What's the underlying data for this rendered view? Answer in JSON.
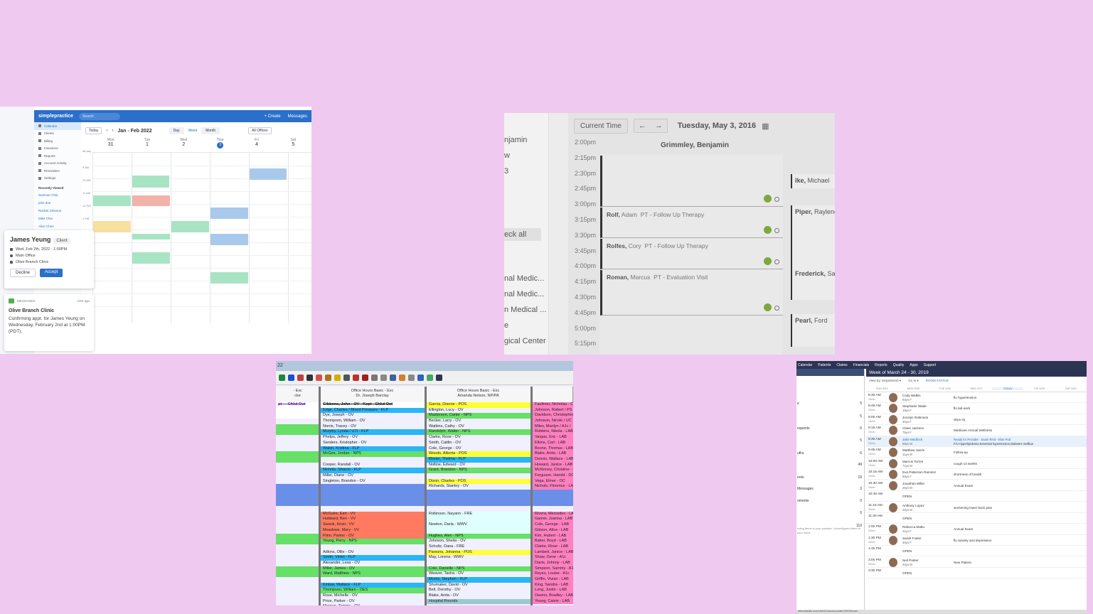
{
  "p1": {
    "logo": "simplepractice",
    "search": "Search",
    "create": "+ Create",
    "messages": "Messages",
    "sidebar": [
      "Calendar",
      "Clients",
      "Billing",
      "Insurance",
      "Reports",
      "Account Activity",
      "Reminders",
      "Settings"
    ],
    "recently_viewed": "Recently Viewed",
    "recent": [
      "Summer Chie",
      "john doe",
      "Rachel Johnson",
      "Mike Chin",
      "Alice Chen"
    ],
    "today": "Today",
    "month_label": "Jan - Feb 2022",
    "views": [
      "Day",
      "Week",
      "Month"
    ],
    "offices": "All Offices",
    "days": [
      {
        "n": "Mon",
        "d": "31"
      },
      {
        "n": "Tue",
        "d": "1"
      },
      {
        "n": "Wed",
        "d": "2"
      },
      {
        "n": "Thur",
        "d": "3"
      },
      {
        "n": "Fri",
        "d": "4"
      },
      {
        "n": "Sat",
        "d": "5"
      }
    ],
    "allday": "all-day",
    "times": [
      "9 AM",
      "10 AM",
      "11 AM",
      "12 PM",
      "1 PM"
    ],
    "card": {
      "name": "James Yeung",
      "tag": "Client",
      "date": "Wed, Feb 2th, 2022 - 1:00PM",
      "office": "Main Office",
      "clinic": "Olive Branch Clinic",
      "decline": "Decline",
      "accept": "Accept"
    },
    "msg": {
      "label": "MESSAGES",
      "ago": "10m ago",
      "title": "Olive Branch Clinic",
      "body": "Confirming appt. for James Yeung on Wednesday, February 2nd at 1:00PM (PDT)."
    }
  },
  "p2": {
    "current_time": "Current Time",
    "prev": "←",
    "next": "→",
    "date": "Tuesday, May 3, 2016",
    "provider": "Grimmley, Benjamin",
    "times": [
      "2:00pm",
      "2:15pm",
      "2:30pm",
      "2:45pm",
      "3:00pm",
      "3:15pm",
      "3:30pm",
      "3:45pm",
      "4:00pm",
      "4:15pm",
      "4:30pm",
      "4:45pm",
      "5:00pm",
      "5:15pm"
    ],
    "left": [
      "njamin",
      "w",
      "3",
      "eck all",
      "nal Medic...",
      "nal Medic...",
      "n Medical ...",
      "e",
      "gical Center"
    ],
    "appts": [
      {
        "last": "Rolf,",
        "first": "Adam",
        "type": "PT - Follow Up Therapy"
      },
      {
        "last": "Rolfes,",
        "first": "Cory",
        "type": "PT - Follow Up Therapy"
      },
      {
        "last": "Roman,",
        "first": "Marcus",
        "type": "PT - Evaluation Visit"
      }
    ],
    "right": [
      {
        "last": "Ike,",
        "first": "Michael"
      },
      {
        "last": "Piper,",
        "first": "Raylene"
      },
      {
        "last": "Frederick,",
        "first": "Sa"
      },
      {
        "last": "Pearl,",
        "first": "Ford"
      }
    ]
  },
  "p3": {
    "title": "22",
    "cols": [
      {
        "h1": "- Exc",
        "h2": "cke"
      },
      {
        "h1": "Office Hours Basic - Exc",
        "h2": "Dr. Joseph Barclay"
      },
      {
        "h1": "Office Hours Basic - Exc",
        "h2": "Amanda Nelson, NP/PA"
      },
      {
        "h1": "",
        "h2": ""
      }
    ],
    "col0": [
      "pt — Chkd Out"
    ],
    "col1": [
      "Gibbons, John - OV - Kept - Chkd Out",
      "Edge, Charles / Blood Pressure - FLP",
      "Dye, Joseph - OV",
      "Thompson, William - OV",
      "Norris, Tracey - OV",
      "Murphy, Lynda / UTI - FLP",
      "Phelps, Jeffery - OV",
      "Sanders, Kristopher - OV",
      "Walsh, Kristina - FLP",
      "McGee, Jordan - NPS",
      "",
      "Cooper, Randall - OV",
      "Nichols, Sharon - FLP",
      "Miller, Diane - OV",
      "Singleton, Brandon - OV",
      "",
      "",
      "",
      "",
      "",
      "McGuire, Earl - VV",
      "Hubbard, Ben - VV",
      "Swank, Kristi - VV",
      "Meadows, Mary - VV",
      "Flinn, Parker - OV",
      "Young, Perry - NPS",
      "",
      "Adkins, Ollie - OV",
      "Smith, Violet - FLP",
      "Alexander, Lesa - OV",
      "Miller, James - OV",
      "Ward, Matthew - NPS",
      "",
      "Kinlaw, Wallace - FLP",
      "Thompson, William - OES",
      "Rose, Michelle - OV",
      "Price, Parker - OV",
      "Morgan, Tammy - OV"
    ],
    "col2": [
      "Garcia, Dianne - POS",
      "Ellington, Lucy - OV",
      "Masterson, Carter - NPS",
      "Becker, Larry - OV",
      "Watkins, Cathy - OV",
      "Randolph, Walter - NPS",
      "Clarke, Rose - OV",
      "Smith, Caitlin - OV",
      "Cole, George - OV",
      "Woods, Alberta - POS",
      "Moran, Thelma - FLP",
      "Nolline, Edward - OV",
      "Grant, Brandon - NPS",
      "",
      "Dixon, Charles - POS",
      "Richards, Stanley - OV",
      "",
      "",
      "",
      "",
      "Robinson, Nayann - FRE",
      "",
      "Newton, Darla - WWV",
      "",
      "Hughes, Alex - NPS",
      "Johnson, Sheila - OV",
      "Schultz, Dana - FRE",
      "Parsons, Johanna - POS",
      "May, Lorena - WWV",
      "",
      "Cole, Danielle - NPS",
      "Weaver, Tasha - OV",
      "Morris, Stephen - FLP",
      "Shumaker, David - OV",
      "Bell, Dorothy - OV",
      "Blake, Anita - OV",
      "Hospital Rounds"
    ],
    "col3": [
      "Faulkner, Nicholas - C",
      "Johnson, Robert / PS",
      "Davidson, Christopher",
      "Johnson, Nicole / UC",
      "Miles, Marilyn / A1c /",
      "Robbins, Nikola - LAB",
      "Vargas, Eric - LAB",
      "Elkins, Carl - LAB",
      "Boone, Thomas - LAB",
      "Blake, Anita - LAB",
      "Dennis, Wallace - LAB",
      "Howard, Janice - LAB",
      "McKinney, Christine - I",
      "Ferguson, Harold - DC",
      "Vega, Elmer - DC",
      "Nichols, Florence - LAB",
      "",
      "",
      "",
      "",
      "Rivera, Mercedes - LA",
      "Garner, Joanna - LAB",
      "Cole, George - LAB",
      "Gibson, Alice - LAB",
      "Kim, Hubert - LAB",
      "Baker, Boyd - LAB",
      "Clarke, Rose - LAB",
      "Lambert, Janice - LAB",
      "Shaw, Gene - A1c",
      "Davis, Johnny - LAB",
      "Simpson, Sammy - A1c",
      "Reyes, Louise - A1c",
      "Griffin, Vivian - LAB",
      "King, Sandra - LAB",
      "Long, Justin - LAB",
      "Owens, Bradley - LAB",
      "Young, Calvin - LAB"
    ]
  },
  "p4": {
    "nav": [
      "Calendar",
      "Patients",
      "Claims",
      "Financials",
      "Reports",
      "Quality",
      "Apps",
      "Support"
    ],
    "week": "Week of March 24 - 30, 2019",
    "viewby": "View by: Department ▾",
    "goto": "Go to ▾",
    "room": "ROOM STATUS",
    "dtabs": [
      "SUN 3/24",
      "MON 3/25",
      "TUE 3/26",
      "WED 3/27",
      "TODAY",
      "FRI 3/29",
      "SAT 3/30"
    ],
    "left": [
      {
        "l": "e",
        "n": "5"
      },
      {
        "l": "",
        "n": "5"
      },
      {
        "l": "equests",
        "n": "6"
      },
      {
        "l": "",
        "n": "5"
      },
      {
        "l": "uths",
        "n": "6"
      },
      {
        "l": "",
        "n": "49"
      },
      {
        "l": "ents",
        "n": "19"
      },
      {
        "l": "Messages",
        "n": "3"
      },
      {
        "l": "oments",
        "n": "0"
      },
      {
        "l": "",
        "n": "0"
      },
      {
        "l": "",
        "n": "110"
      }
    ],
    "left_note": "nding items in your practice. Unconfigured them in your inbox",
    "appts": [
      {
        "t": "8:30 AM",
        "d": "15min",
        "n": "Cody Walkin",
        "a": "83yo F",
        "r": "flu hypertension"
      },
      {
        "t": "8:45 AM",
        "d": "15min",
        "n": "Stephanie Wade",
        "a": "19yo F",
        "r": "flu lab work"
      },
      {
        "t": "9:00 AM",
        "d": "15min",
        "n": "Jocelyn Robinson",
        "a": "34yo F",
        "r": "depo inj"
      },
      {
        "t": "9:15 AM",
        "d": "30min",
        "n": "Claire Jackson",
        "a": "75yo F",
        "r": "Medicare Annual Wellness"
      },
      {
        "t": "9:30 AM",
        "d": "15min",
        "n": "Jake Medlock",
        "a": "69yo M",
        "r1": "Ready for Provider · Exam Rm3 - Blue Pod",
        "r2": "F/U Hyperlipidemia Essential hypertension,Diabetes mellitus",
        "hl": true
      },
      {
        "t": "9:45 AM",
        "d": "15min",
        "n": "Matthew Harris",
        "a": "31yo M",
        "r": "Follow-up"
      },
      {
        "t": "10:00 AM",
        "d": "15min",
        "n": "Marcus Torres",
        "a": "71yo M",
        "r": "cough x3 weeks"
      },
      {
        "t": "10:15 AM",
        "d": "15min",
        "n": "Eva Patterson Ramirez",
        "a": "55yo F",
        "r": "shortness of breath"
      },
      {
        "t": "10:30 AM",
        "d": "15min",
        "n": "Jonathan Miller",
        "a": "26yo M",
        "r": "Annual Exam"
      },
      {
        "t": "10:45 AM",
        "open": "OPEN"
      },
      {
        "t": "11:15 AM",
        "d": "30min",
        "n": "Anthony Lopez",
        "a": "44yo M",
        "r": "worsening lower back pain"
      },
      {
        "t": "11:30 AM",
        "open": "OPEN"
      },
      {
        "t": "1:00 PM",
        "d": "30min",
        "n": "Rebecca Mattu",
        "a": "21yo F",
        "r": "Annual Exam"
      },
      {
        "t": "1:30 PM",
        "d": "15min",
        "n": "Sarah Foster",
        "a": "40yo F",
        "r": "flu anxiety and depression"
      },
      {
        "t": "1:45 PM",
        "open": "OPEN"
      },
      {
        "t": "3:00 PM",
        "d": "30min",
        "n": "Neil Parker",
        "a": "20yo M",
        "r": "New Patient"
      },
      {
        "t": "3:30 PM",
        "open": "OPEN"
      }
    ],
    "footer": "athenahealth.com/1504312/ax/encounter/78578/exam"
  }
}
